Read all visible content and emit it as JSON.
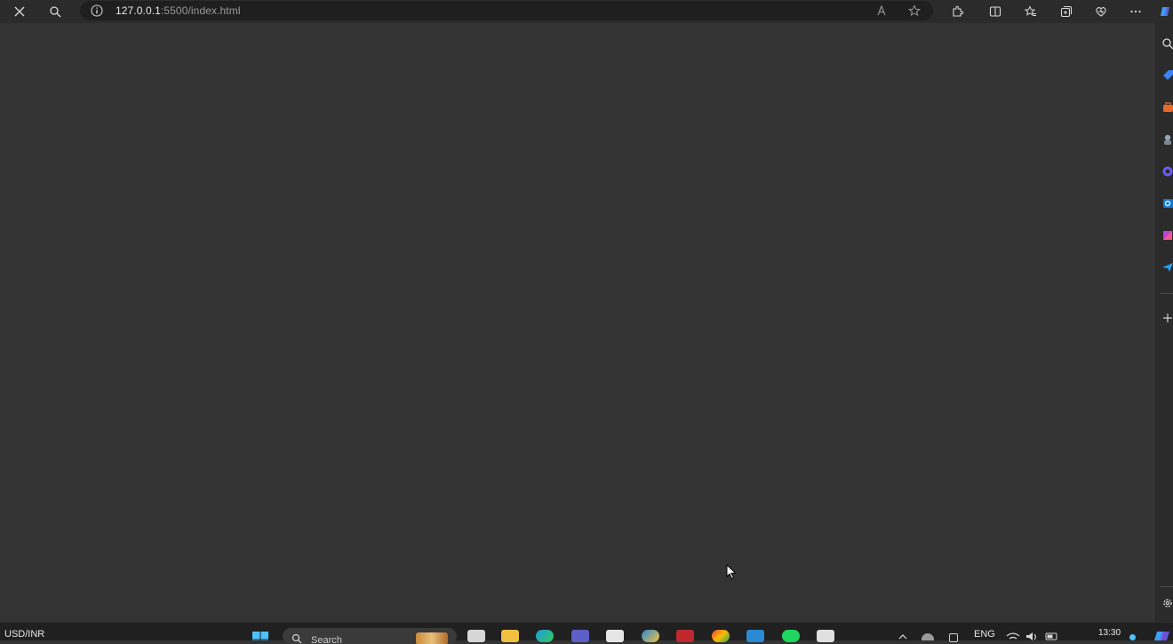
{
  "browser": {
    "url_host": "127.0.0.1",
    "url_rest": ":5500/index.html"
  },
  "taskbar": {
    "widget": "USD/INR",
    "search_placeholder": "Search",
    "language": "ENG",
    "time": "13:30"
  }
}
